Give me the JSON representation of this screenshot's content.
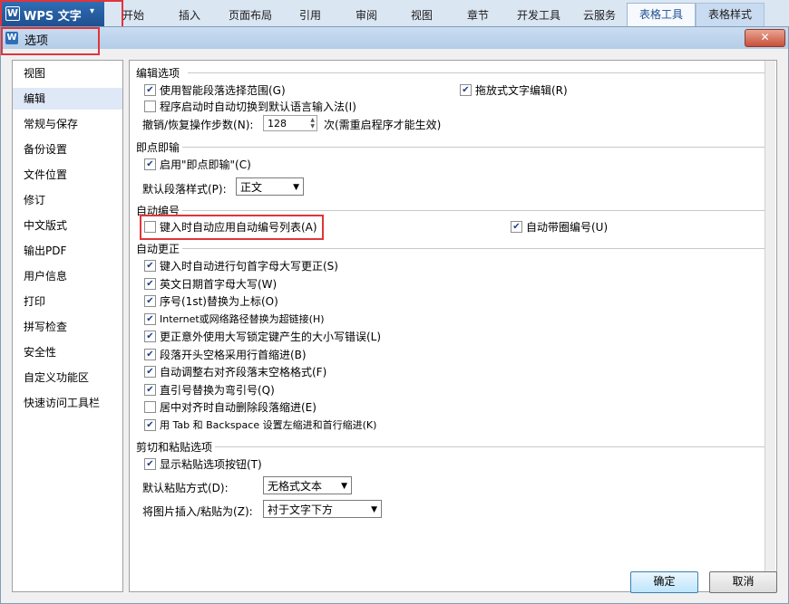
{
  "app": {
    "name": "WPS 文字",
    "logo_glyph": "W"
  },
  "ribbon": {
    "tabs": [
      "开始",
      "插入",
      "页面布局",
      "引用",
      "审阅",
      "视图",
      "章节",
      "开发工具",
      "云服务",
      "表格工具",
      "表格样式"
    ],
    "active_tab": "表格工具"
  },
  "dialog": {
    "title": "选项",
    "close_glyph": "✕"
  },
  "sidebar": {
    "items": [
      "视图",
      "编辑",
      "常规与保存",
      "备份设置",
      "文件位置",
      "修订",
      "中文版式",
      "输出PDF",
      "用户信息",
      "打印",
      "拼写检查",
      "安全性",
      "自定义功能区",
      "快速访问工具栏"
    ],
    "selected": "编辑"
  },
  "sections": {
    "edit": {
      "title": "编辑选项",
      "smart_select": {
        "label": "使用智能段落选择范围(G)",
        "checked": true
      },
      "drag_edit": {
        "label": "拖放式文字编辑(R)",
        "checked": true
      },
      "ime_switch": {
        "label": "程序启动时自动切换到默认语言输入法(I)",
        "checked": false
      },
      "undo_label": "撤销/恢复操作步数(N):",
      "undo_value": "128",
      "undo_suffix": "次(需重启程序才能生效)"
    },
    "click_type": {
      "title": "即点即输",
      "enable": {
        "label": "启用\"即点即输\"(C)",
        "checked": true
      },
      "style_label": "默认段落样式(P):",
      "style_value": "正文"
    },
    "autonum": {
      "title": "自动编号",
      "auto_list": {
        "label": "键入时自动应用自动编号列表(A)",
        "checked": false
      },
      "circle_num": {
        "label": "自动带圈编号(U)",
        "checked": true
      }
    },
    "autocorrect": {
      "title": "自动更正",
      "items": [
        {
          "label": "键入时自动进行句首字母大写更正(S)",
          "checked": true
        },
        {
          "label": "英文日期首字母大写(W)",
          "checked": true
        },
        {
          "label": "序号(1st)替换为上标(O)",
          "checked": true
        },
        {
          "label": "Internet或网络路径替换为超链接(H)",
          "checked": true
        },
        {
          "label": "更正意外使用大写锁定键产生的大小写错误(L)",
          "checked": true
        },
        {
          "label": "段落开头空格采用行首缩进(B)",
          "checked": true
        },
        {
          "label": "自动调整右对齐段落末空格格式(F)",
          "checked": true
        },
        {
          "label": "直引号替换为弯引号(Q)",
          "checked": true
        },
        {
          "label": "居中对齐时自动删除段落缩进(E)",
          "checked": false
        },
        {
          "label": "用 Tab 和 Backspace 设置左缩进和首行缩进(K)",
          "checked": true
        }
      ]
    },
    "paste": {
      "title": "剪切和粘贴选项",
      "show_btn": {
        "label": "显示粘贴选项按钮(T)",
        "checked": true
      },
      "default_label": "默认粘贴方式(D):",
      "default_value": "无格式文本",
      "image_label": "将图片插入/粘贴为(Z):",
      "image_value": "衬于文字下方"
    }
  },
  "footer": {
    "ok": "确定",
    "cancel": "取消"
  },
  "colors": {
    "highlight": "#e0353a",
    "check": "#1a3f8a"
  }
}
